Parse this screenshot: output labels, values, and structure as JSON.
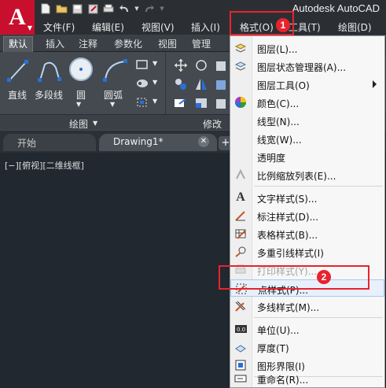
{
  "window": {
    "title": "Autodesk AutoCAD"
  },
  "app_logo": {
    "letter": "A"
  },
  "menubar": {
    "items": [
      "文件(F)",
      "编辑(E)",
      "视图(V)",
      "插入(I)",
      "格式(O)",
      "工具(T)",
      "绘图(D)"
    ]
  },
  "ribbon": {
    "tabs": [
      "默认",
      "插入",
      "注释",
      "参数化",
      "视图",
      "管理"
    ],
    "tools": {
      "line": "直线",
      "polyline": "多段线",
      "circle": "圆",
      "arc": "圆弧"
    },
    "panels": {
      "draw": "绘图",
      "modify": "修改"
    }
  },
  "filetabs": {
    "start": "开始",
    "drawing": "Drawing1*",
    "add": "+"
  },
  "viewport": {
    "label": "[−][俯视][二维线框]"
  },
  "format_menu": {
    "items": [
      {
        "label": "图层(L)...",
        "icon": "layer-icon"
      },
      {
        "label": "图层状态管理器(A)...",
        "icon": "layer-state-icon"
      },
      {
        "label": "图层工具(O)",
        "icon": "",
        "submenu": true
      },
      {
        "label": "颜色(C)...",
        "icon": "color-wheel-icon"
      },
      {
        "label": "线型(N)...",
        "icon": ""
      },
      {
        "label": "线宽(W)...",
        "icon": ""
      },
      {
        "label": "透明度",
        "icon": ""
      },
      {
        "label": "比例缩放列表(E)...",
        "icon": "scale-list-icon"
      },
      {
        "label": "文字样式(S)...",
        "icon": "text-style-icon"
      },
      {
        "label": "标注样式(D)...",
        "icon": "dimension-style-icon"
      },
      {
        "label": "表格样式(B)...",
        "icon": "table-style-icon"
      },
      {
        "label": "多重引线样式(I)",
        "icon": "multileader-style-icon"
      },
      {
        "label": "打印样式(Y)...",
        "icon": "plot-style-icon",
        "disabled": true
      },
      {
        "label": "点样式(P)...",
        "icon": "point-style-icon"
      },
      {
        "label": "多线样式(M)...",
        "icon": "multiline-style-icon"
      },
      {
        "label": "单位(U)...",
        "icon": "units-icon"
      },
      {
        "label": "厚度(T)",
        "icon": "thickness-icon"
      },
      {
        "label": "图形界限(I)",
        "icon": "drawing-limits-icon"
      },
      {
        "label": "重命名(R)...",
        "icon": "rename-icon"
      }
    ]
  },
  "annotations": {
    "step1": "1",
    "step2": "2"
  },
  "colors": {
    "highlight": "#e8232e",
    "logo": "#c8102e"
  }
}
